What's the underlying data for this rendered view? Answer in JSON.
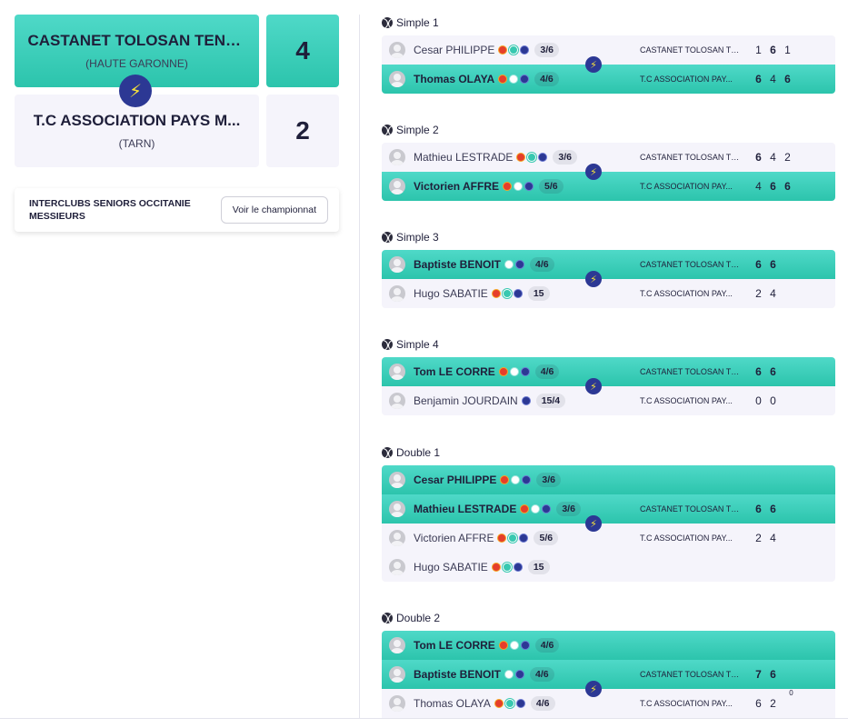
{
  "encounter": {
    "home": {
      "name": "CASTANET TOLOSAN TENNI...",
      "region": "(HAUTE GARONNE)",
      "score": "4"
    },
    "away": {
      "name": "T.C ASSOCIATION PAYS M...",
      "region": "(TARN)",
      "score": "2"
    },
    "championship": {
      "title": "INTERCLUBS SENIORS OCCITANIE MESSIEURS",
      "button": "Voir le championnat"
    }
  },
  "icons": {
    "bolt": "⚡"
  },
  "matches": [
    {
      "title": "Simple 1",
      "rows": [
        {
          "player": "Cesar PHILIPPE",
          "rank": "3/6",
          "club": "",
          "sets": []
        },
        {
          "player": "",
          "rank": "",
          "club": "CASTANET TOLOSAN TE...",
          "sets": [
            "1",
            "6",
            "1"
          ]
        },
        {
          "player": "Thomas OLAYA",
          "rank": "4/6",
          "club": "T.C ASSOCIATION PAY...",
          "sets": [
            "6",
            "4",
            "6"
          ]
        }
      ],
      "p1": {
        "name": "Cesar PHILIPPE",
        "rank": "3/6",
        "club": "CASTANET TOLOSAN TE...",
        "sets": [
          "1",
          "6",
          "1"
        ]
      },
      "p2": {
        "name": "Thomas OLAYA",
        "rank": "4/6",
        "club": "T.C ASSOCIATION PAY...",
        "sets": [
          "6",
          "4",
          "6"
        ]
      }
    },
    {
      "title": "Simple 2",
      "p1": {
        "name": "Mathieu LESTRADE",
        "rank": "3/6",
        "club": "CASTANET TOLOSAN TE...",
        "sets": [
          "6",
          "4",
          "2"
        ]
      },
      "p2": {
        "name": "Victorien AFFRE",
        "rank": "5/6",
        "club": "T.C ASSOCIATION PAY...",
        "sets": [
          "4",
          "6",
          "6"
        ]
      }
    },
    {
      "title": "Simple 3",
      "p1": {
        "name": "Baptiste BENOIT",
        "rank": "4/6",
        "club": "CASTANET TOLOSAN TE...",
        "sets": [
          "6",
          "6"
        ]
      },
      "p2": {
        "name": "Hugo SABATIE",
        "rank": "15",
        "club": "T.C ASSOCIATION PAY...",
        "sets": [
          "2",
          "4"
        ]
      }
    },
    {
      "title": "Simple 4",
      "p1": {
        "name": "Tom LE CORRE",
        "rank": "4/6",
        "club": "CASTANET TOLOSAN TE...",
        "sets": [
          "6",
          "6"
        ]
      },
      "p2": {
        "name": "Benjamin JOURDAIN",
        "rank": "15/4",
        "club": "T.C ASSOCIATION PAY...",
        "sets": [
          "0",
          "0"
        ]
      }
    },
    {
      "title": "Double 1",
      "p1a": {
        "name": "Cesar PHILIPPE",
        "rank": "3/6"
      },
      "p1b": {
        "name": "Mathieu LESTRADE",
        "rank": "3/6"
      },
      "p1_club": "CASTANET TOLOSAN TE...",
      "p1_sets": [
        "6",
        "6"
      ],
      "p2a": {
        "name": "Victorien AFFRE",
        "rank": "5/6"
      },
      "p2b": {
        "name": "Hugo SABATIE",
        "rank": "15"
      },
      "p2_club": "T.C ASSOCIATION PAY...",
      "p2_sets": [
        "2",
        "4"
      ]
    },
    {
      "title": "Double 2",
      "p1a": {
        "name": "Tom LE CORRE",
        "rank": "4/6"
      },
      "p1b": {
        "name": "Baptiste BENOIT",
        "rank": "4/6"
      },
      "p1_club": "CASTANET TOLOSAN TE...",
      "p1_sets": [
        "7",
        "6"
      ],
      "p2a": {
        "name": "Thomas OLAYA",
        "rank": "4/6"
      },
      "p2_club": "T.C ASSOCIATION PAY...",
      "p2_sets": [
        "6",
        "2"
      ],
      "p2_tiebreak": "0"
    }
  ]
}
